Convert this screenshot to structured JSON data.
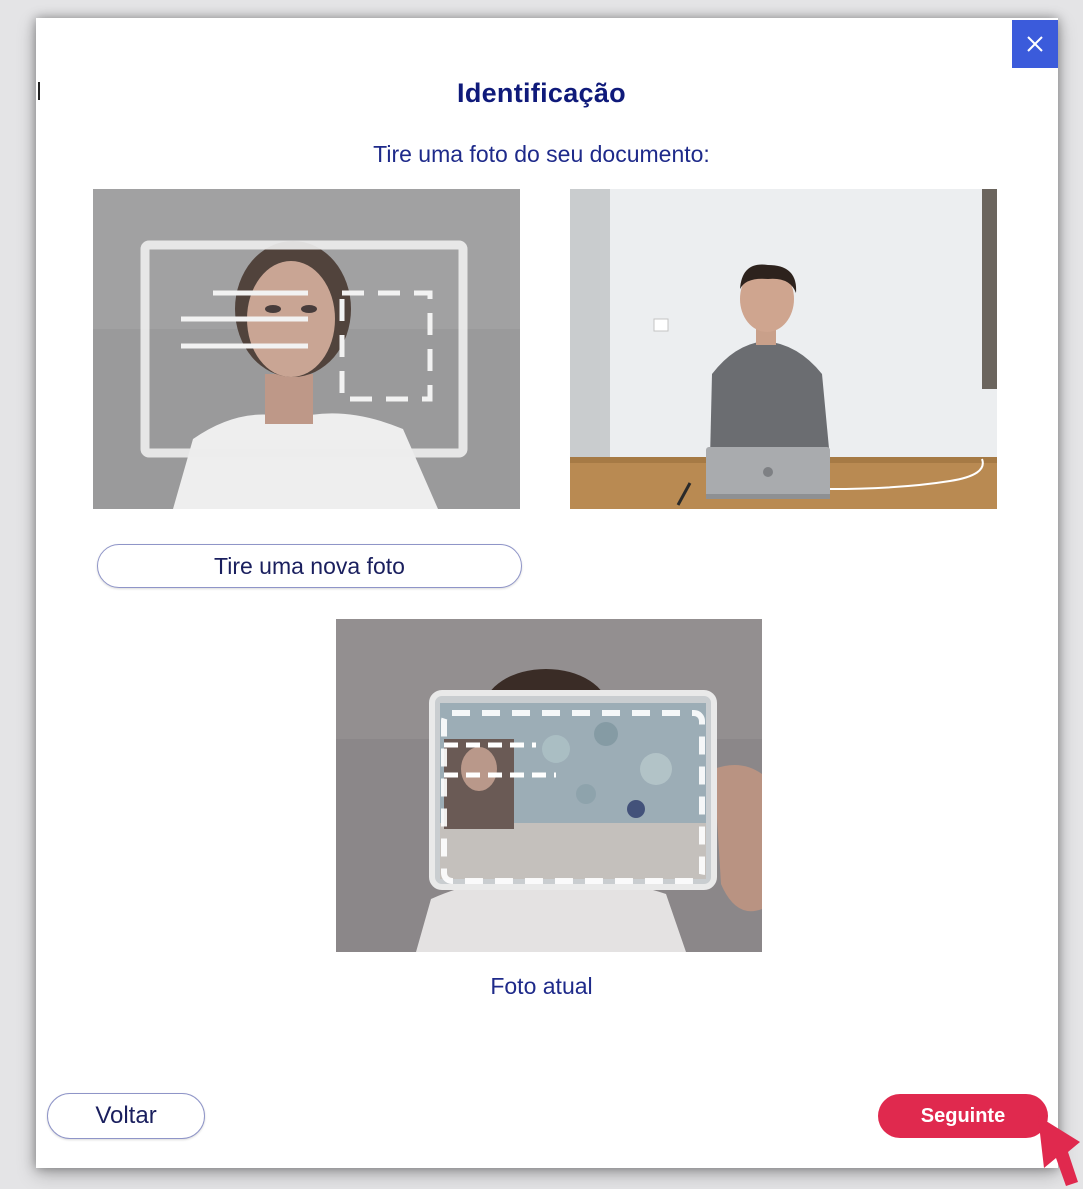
{
  "dialog": {
    "title": "Identificação",
    "subtitle": "Tire uma foto do seu documento:",
    "close_icon": "close-icon",
    "retake_label": "Tire uma nova foto",
    "current_caption": "Foto atual",
    "back_label": "Voltar",
    "next_label": "Seguinte"
  },
  "colors": {
    "title": "#0f1a7a",
    "accent_blue": "#3b5bdb",
    "next_button": "#e0294e",
    "pointer": "#e0294e"
  }
}
